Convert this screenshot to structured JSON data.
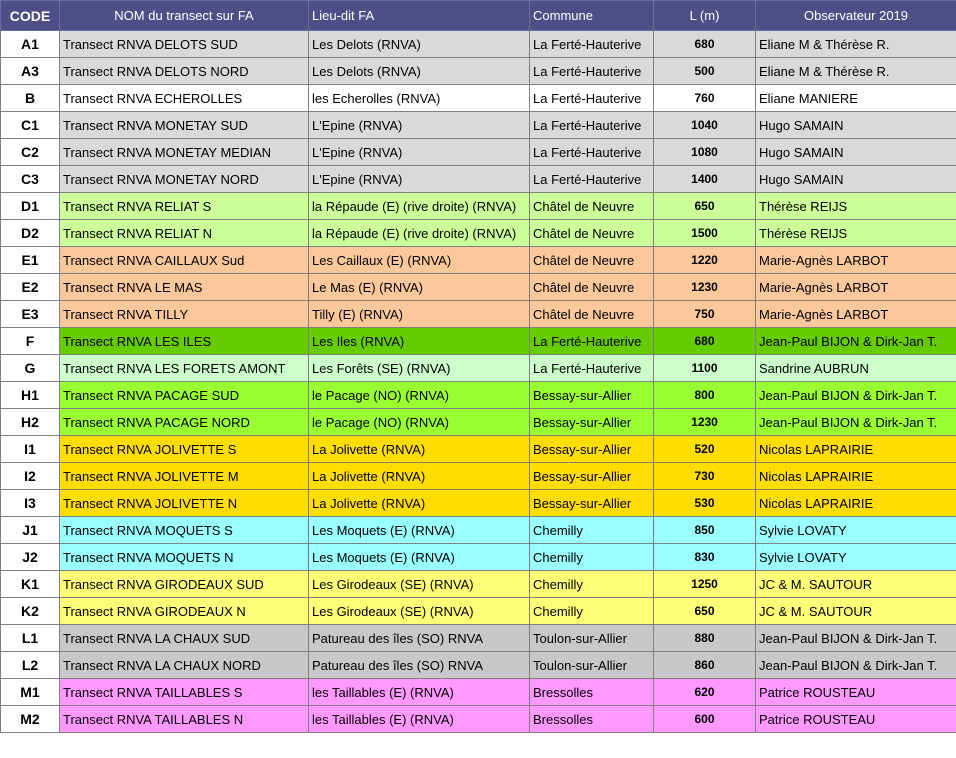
{
  "header": {
    "code": "CODE",
    "nom": "NOM du transect sur FA",
    "lieu": "Lieu-dit FA",
    "commune": "Commune",
    "longueur": "L (m)",
    "observateur": "Observateur 2019"
  },
  "rows": [
    {
      "code": "A1",
      "nom": "Transect RNVA DELOTS SUD",
      "lieu": "Les Delots (RNVA)",
      "commune": "La Ferté-Hauterive",
      "longueur": "680",
      "observateur": "Eliane M & Thérèse R.",
      "color": "#d9d9d9"
    },
    {
      "code": "A3",
      "nom": "Transect RNVA DELOTS NORD",
      "lieu": "Les Delots (RNVA)",
      "commune": "La Ferté-Hauterive",
      "longueur": "500",
      "observateur": "Eliane M & Thérèse R.",
      "color": "#d9d9d9"
    },
    {
      "code": "B",
      "nom": "Transect RNVA ECHEROLLES",
      "lieu": "les Echerolles (RNVA)",
      "commune": "La Ferté-Hauterive",
      "longueur": "760",
      "observateur": "Eliane MANIERE",
      "color": "#ffffff"
    },
    {
      "code": "C1",
      "nom": "Transect RNVA MONETAY SUD",
      "lieu": "L'Epine (RNVA)",
      "commune": "La Ferté-Hauterive",
      "longueur": "1040",
      "observateur": "Hugo SAMAIN",
      "color": "#d9d9d9"
    },
    {
      "code": "C2",
      "nom": "Transect RNVA MONETAY MEDIAN",
      "lieu": "L'Epine (RNVA)",
      "commune": "La Ferté-Hauterive",
      "longueur": "1080",
      "observateur": "Hugo SAMAIN",
      "color": "#d9d9d9"
    },
    {
      "code": "C3",
      "nom": "Transect RNVA MONETAY NORD",
      "lieu": "L'Epine (RNVA)",
      "commune": "La Ferté-Hauterive",
      "longueur": "1400",
      "observateur": "Hugo SAMAIN",
      "color": "#d9d9d9"
    },
    {
      "code": "D1",
      "nom": "Transect RNVA RELIAT S",
      "lieu": "la Répaude (E) (rive droite) (RNVA)",
      "commune": "Châtel de Neuvre",
      "longueur": "650",
      "observateur": "Thérèse REIJS",
      "color": "#ccff99"
    },
    {
      "code": "D2",
      "nom": "Transect RNVA RELIAT N",
      "lieu": "la Répaude (E) (rive droite) (RNVA)",
      "commune": "Châtel de Neuvre",
      "longueur": "1500",
      "observateur": "Thérèse REIJS",
      "color": "#ccff99"
    },
    {
      "code": "E1",
      "nom": "Transect RNVA CAILLAUX Sud",
      "lieu": "Les Caillaux (E) (RNVA)",
      "commune": "Châtel de Neuvre",
      "longueur": "1220",
      "observateur": "Marie-Agnès LARBOT",
      "color": "#fbc89c"
    },
    {
      "code": "E2",
      "nom": "Transect RNVA LE MAS",
      "lieu": "Le Mas (E) (RNVA)",
      "commune": "Châtel de Neuvre",
      "longueur": "1230",
      "observateur": "Marie-Agnès LARBOT",
      "color": "#fbc89c"
    },
    {
      "code": "E3",
      "nom": "Transect RNVA TILLY",
      "lieu": "Tilly (E) (RNVA)",
      "commune": "Châtel de Neuvre",
      "longueur": "750",
      "observateur": "Marie-Agnès LARBOT",
      "color": "#fbc89c"
    },
    {
      "code": "F",
      "nom": "Transect RNVA LES ILES",
      "lieu": "Les Iles (RNVA)",
      "commune": "La Ferté-Hauterive",
      "longueur": "680",
      "observateur": "Jean-Paul BIJON  & Dirk-Jan T.",
      "color": "#66cc00"
    },
    {
      "code": "G",
      "nom": "Transect RNVA LES FORETS AMONT",
      "lieu": "Les Forêts (SE) (RNVA)",
      "commune": "La Ferté-Hauterive",
      "longueur": "1100",
      "observateur": "Sandrine AUBRUN",
      "color": "#ccffcc"
    },
    {
      "code": "H1",
      "nom": "Transect RNVA PACAGE SUD",
      "lieu": " le Pacage (NO) (RNVA)",
      "commune": "Bessay-sur-Allier",
      "longueur": "800",
      "observateur": "Jean-Paul BIJON  & Dirk-Jan T.",
      "color": "#99ff33"
    },
    {
      "code": "H2",
      "nom": "Transect RNVA PACAGE NORD",
      "lieu": " le Pacage (NO) (RNVA)",
      "commune": "Bessay-sur-Allier",
      "longueur": "1230",
      "observateur": "Jean-Paul BIJON  & Dirk-Jan T.",
      "color": "#99ff33"
    },
    {
      "code": "I1",
      "nom": "Transect RNVA JOLIVETTE S",
      "lieu": "La Jolivette (RNVA)",
      "commune": "Bessay-sur-Allier",
      "longueur": "520",
      "observateur": "Nicolas LAPRAIRIE",
      "color": "#ffdd00"
    },
    {
      "code": "I2",
      "nom": "Transect RNVA JOLIVETTE M",
      "lieu": "La Jolivette (RNVA)",
      "commune": "Bessay-sur-Allier",
      "longueur": "730",
      "observateur": "Nicolas LAPRAIRIE",
      "color": "#ffdd00"
    },
    {
      "code": "I3",
      "nom": "Transect RNVA JOLIVETTE N",
      "lieu": "La Jolivette (RNVA)",
      "commune": "Bessay-sur-Allier",
      "longueur": "530",
      "observateur": "Nicolas LAPRAIRIE",
      "color": "#ffdd00"
    },
    {
      "code": "J1",
      "nom": "Transect RNVA MOQUETS S",
      "lieu": "Les Moquets (E) (RNVA)",
      "commune": "Chemilly",
      "longueur": "850",
      "observateur": "Sylvie LOVATY",
      "color": "#99ffff"
    },
    {
      "code": "J2",
      "nom": "Transect RNVA MOQUETS N",
      "lieu": "Les Moquets (E) (RNVA)",
      "commune": "Chemilly",
      "longueur": "830",
      "observateur": "Sylvie LOVATY",
      "color": "#99ffff"
    },
    {
      "code": "K1",
      "nom": "Transect RNVA GIRODEAUX SUD",
      "lieu": "Les Girodeaux (SE) (RNVA)",
      "commune": "Chemilly",
      "longueur": "1250",
      "observateur": "JC & M. SAUTOUR",
      "color": "#ffff77"
    },
    {
      "code": "K2",
      "nom": "Transect RNVA GIRODEAUX N",
      "lieu": "Les Girodeaux (SE) (RNVA)",
      "commune": "Chemilly",
      "longueur": "650",
      "observateur": "JC & M. SAUTOUR",
      "color": "#ffff77"
    },
    {
      "code": "L1",
      "nom": "Transect RNVA LA CHAUX SUD",
      "lieu": "Patureau des îles (SO) RNVA",
      "commune": "Toulon-sur-Allier",
      "longueur": "880",
      "observateur": "Jean-Paul BIJON  & Dirk-Jan T.",
      "color": "#c8c8c8"
    },
    {
      "code": "L2",
      "nom": "Transect RNVA LA CHAUX NORD",
      "lieu": "Patureau des îles (SO) RNVA",
      "commune": "Toulon-sur-Allier",
      "longueur": "860",
      "observateur": " Jean-Paul BIJON  & Dirk-Jan T.",
      "color": "#c8c8c8"
    },
    {
      "code": "M1",
      "nom": "Transect RNVA TAILLABLES S",
      "lieu": "les Taillables (E) (RNVA)",
      "commune": "Bressolles",
      "longueur": "620",
      "observateur": "Patrice ROUSTEAU",
      "color": "#ff99ff"
    },
    {
      "code": "M2",
      "nom": "Transect RNVA TAILLABLES N",
      "lieu": "les Taillables (E) (RNVA)",
      "commune": "Bressolles",
      "longueur": "600",
      "observateur": "Patrice ROUSTEAU",
      "color": "#ff99ff"
    }
  ]
}
